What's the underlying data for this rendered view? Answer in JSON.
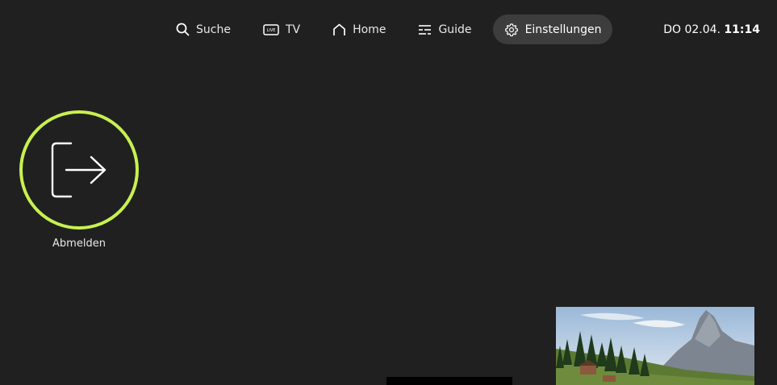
{
  "nav": {
    "items": [
      {
        "label": "Suche",
        "icon": "search-icon"
      },
      {
        "label": "TV",
        "icon": "live-tv-icon",
        "badge": "LIVE"
      },
      {
        "label": "Home",
        "icon": "home-icon"
      },
      {
        "label": "Guide",
        "icon": "guide-icon"
      },
      {
        "label": "Einstellungen",
        "icon": "gear-icon",
        "active": true
      }
    ]
  },
  "clock": {
    "day": "DO 02.04.",
    "time": "11:14"
  },
  "tile": {
    "label": "Abmelden",
    "icon": "logout-icon"
  },
  "colors": {
    "background": "#202020",
    "accent": "#c8f050",
    "active_pill": "#3d3d3d"
  }
}
